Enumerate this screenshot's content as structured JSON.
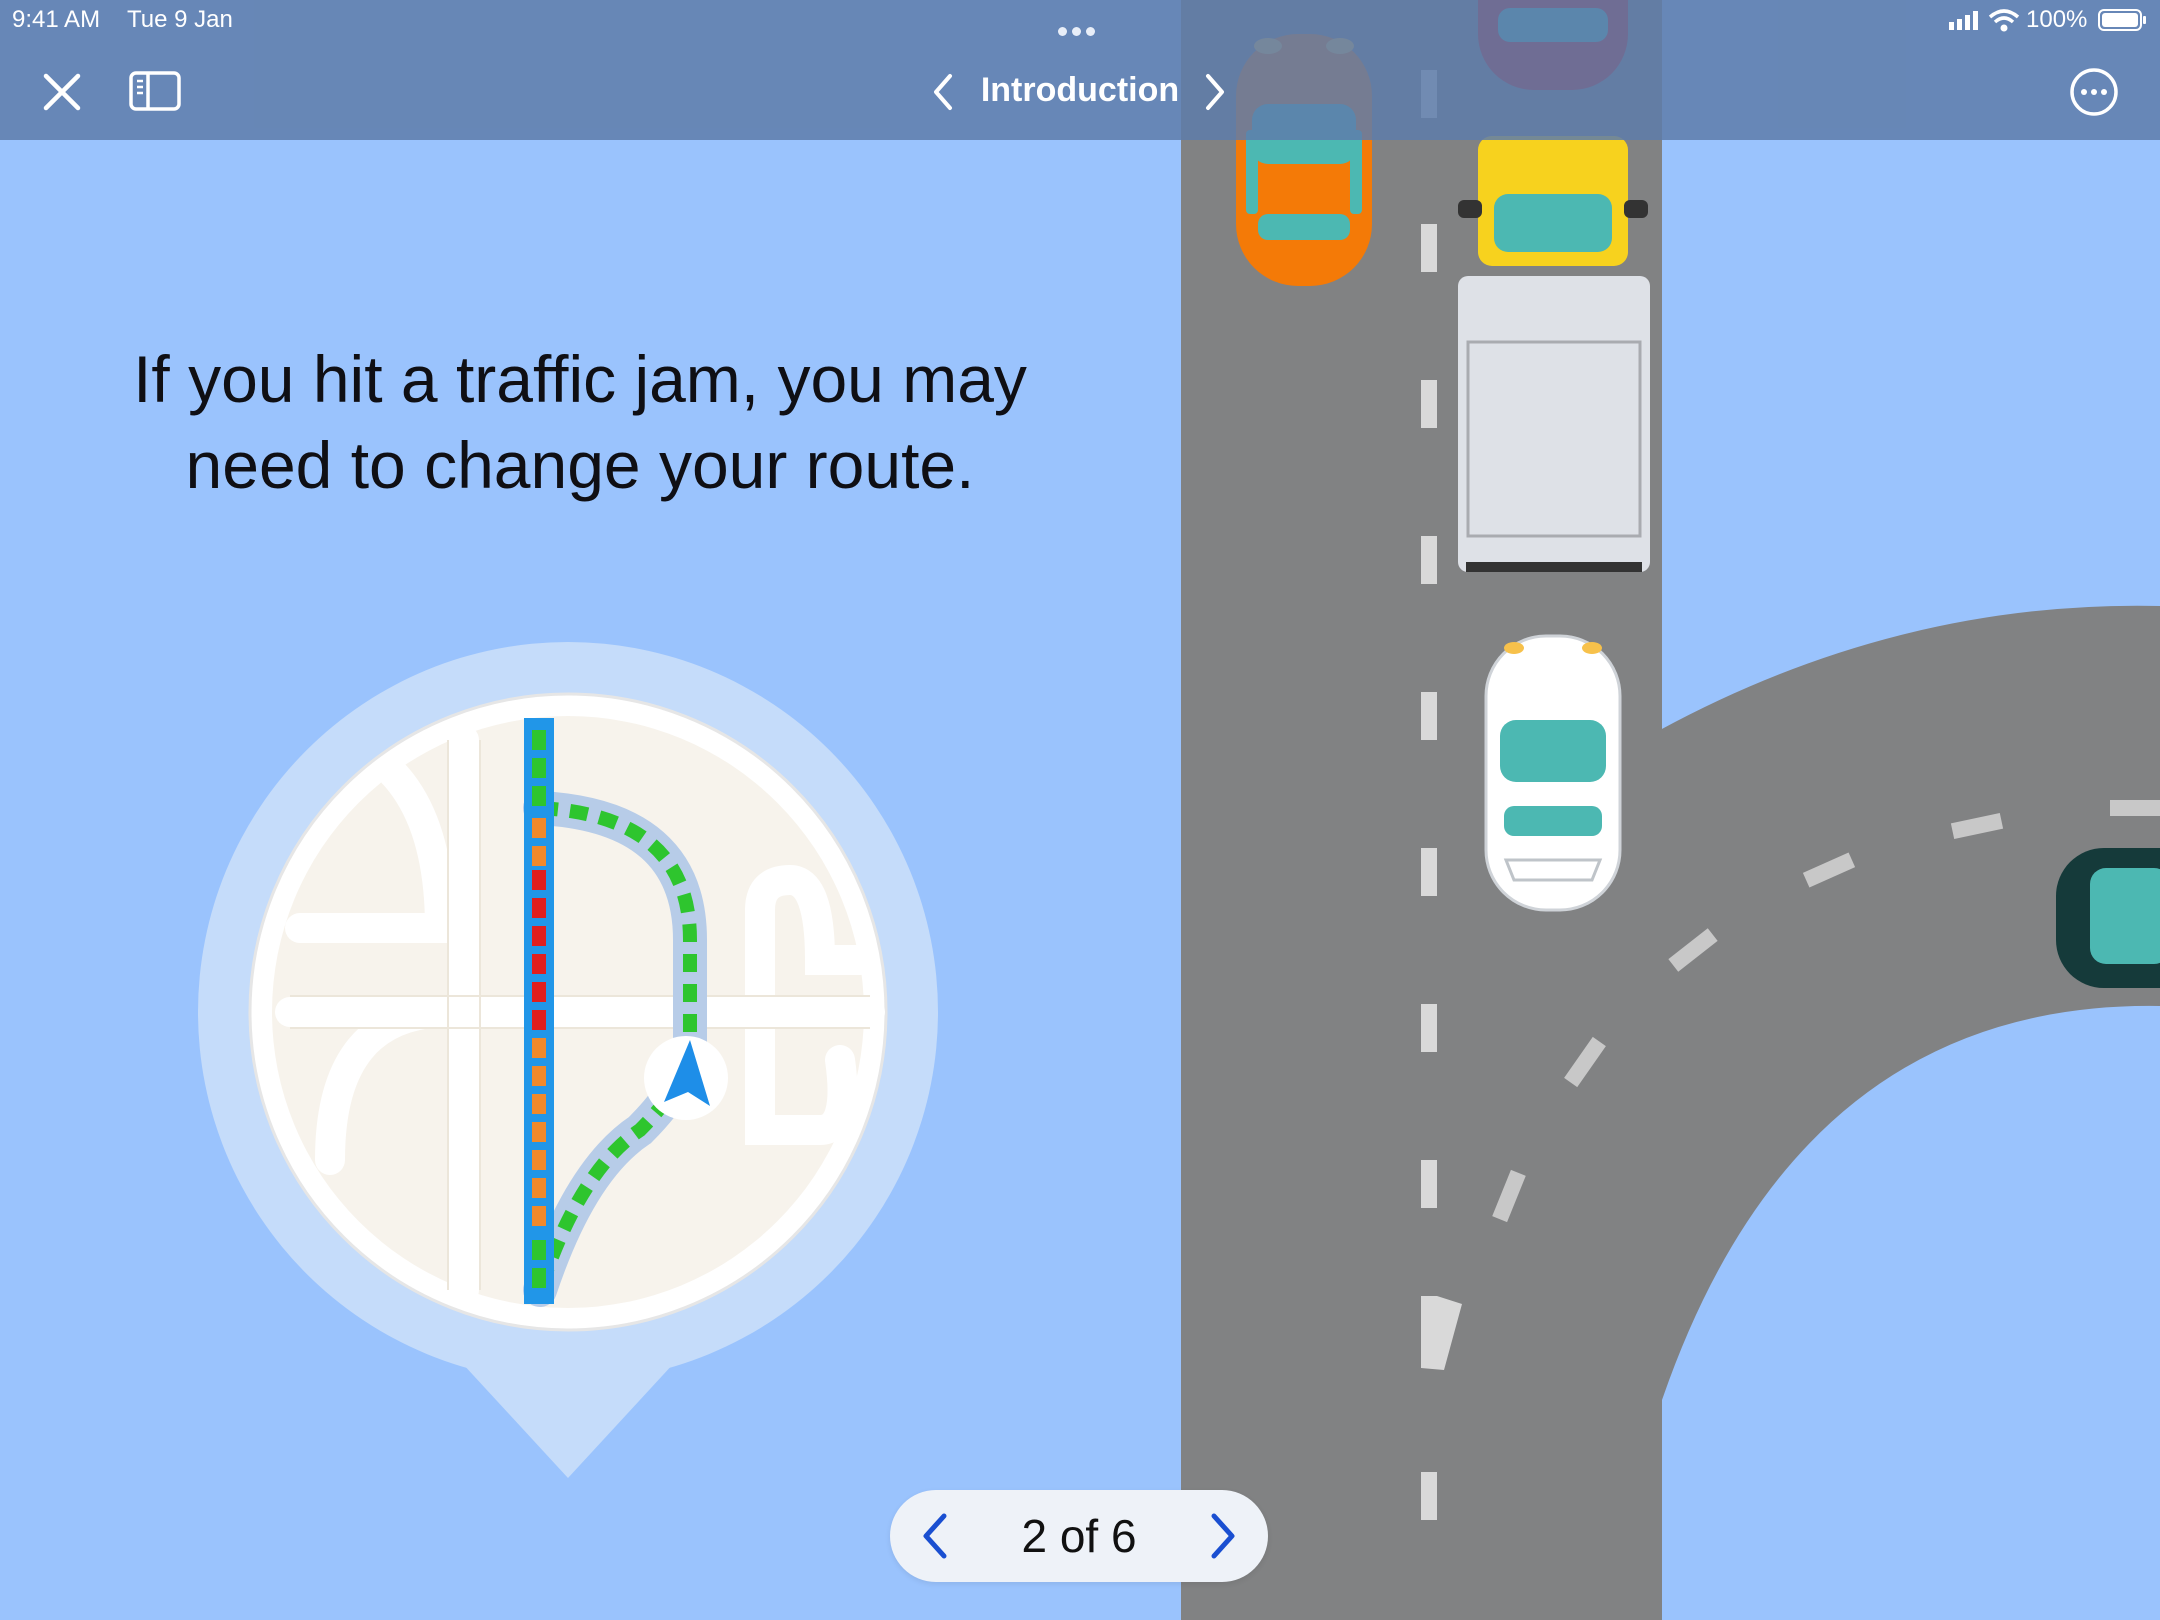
{
  "status_bar": {
    "time": "9:41 AM",
    "date": "Tue 9 Jan",
    "battery_percent": "100%"
  },
  "nav": {
    "chapter_title": "Introduction",
    "close_icon": "close-icon",
    "sidebar_icon": "sidebar-icon",
    "more_icon": "ellipsis-circle-icon",
    "prev_icon": "chevron-left-icon",
    "next_icon": "chevron-right-icon"
  },
  "content": {
    "heading": "If you hit a traffic jam, you may need to change your route."
  },
  "pager": {
    "label": "2 of 6",
    "current": 2,
    "total": 6
  },
  "colors": {
    "background": "#9ac3fd",
    "road": "#818283",
    "accent_blue": "#1a4fd1",
    "route_green": "#2ec52e",
    "traffic_orange": "#f0892a",
    "traffic_red": "#e01e1e"
  }
}
